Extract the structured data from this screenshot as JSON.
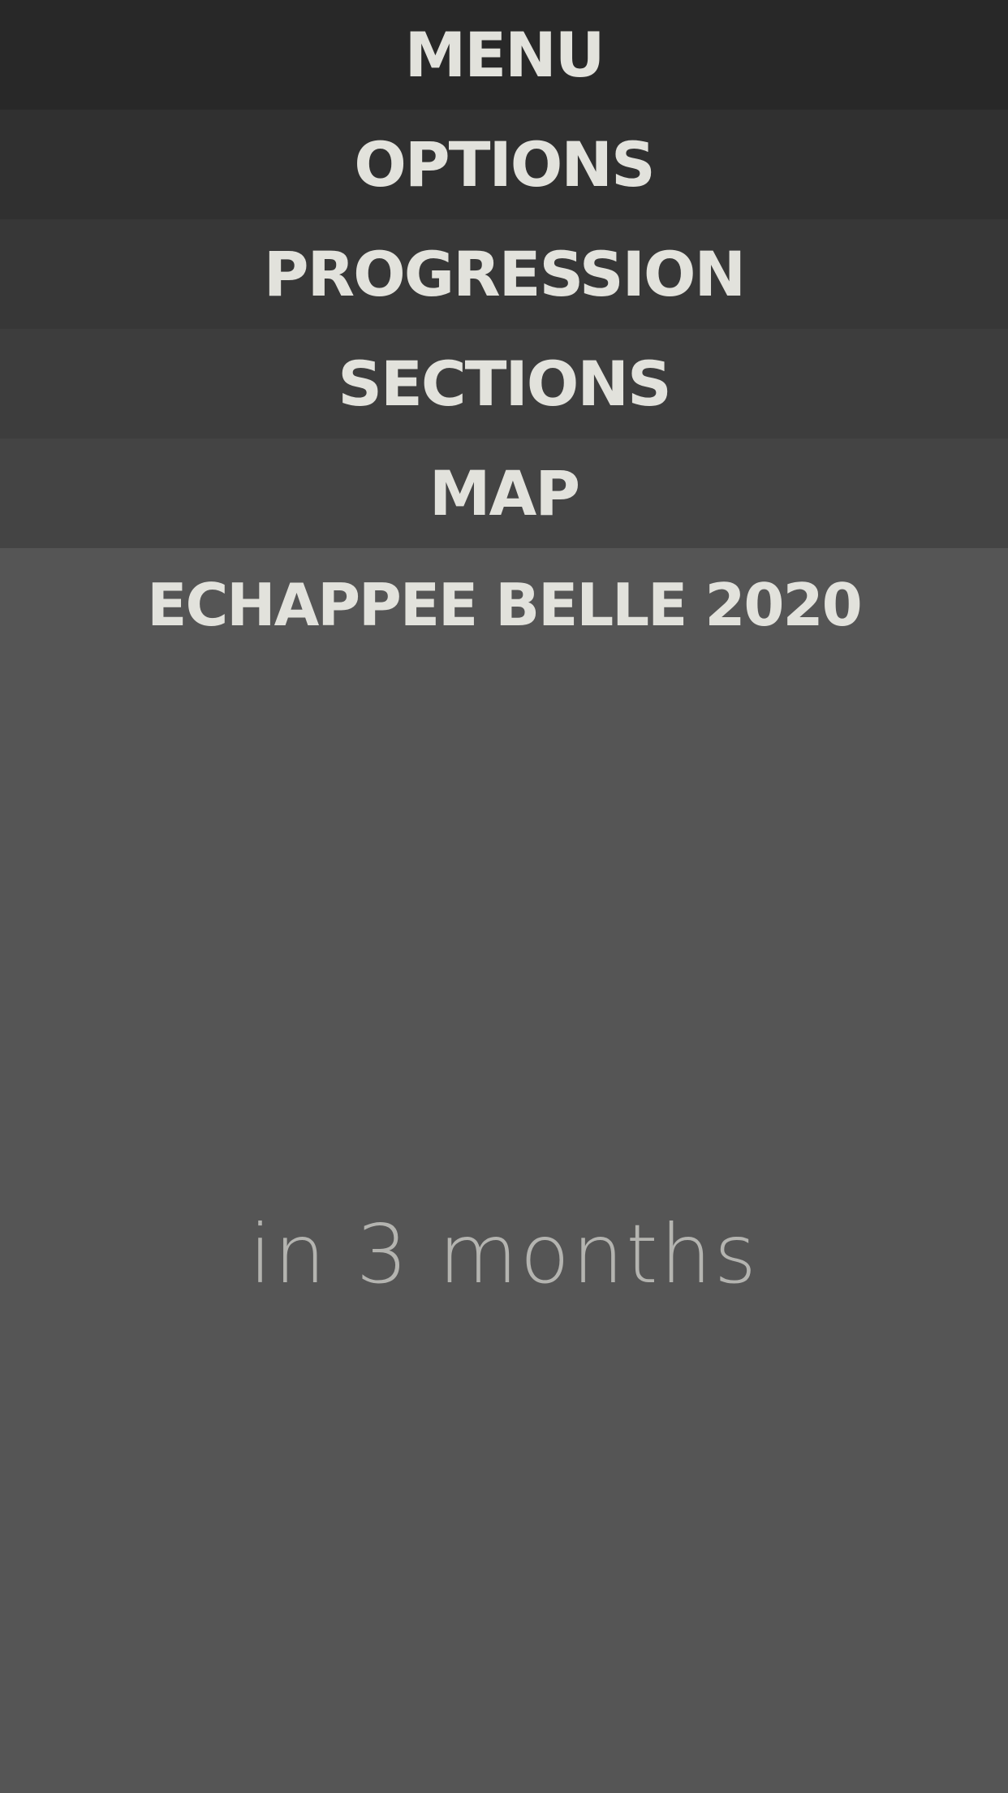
{
  "menu": {
    "items": [
      {
        "label": "MENU",
        "bg": "#282828"
      },
      {
        "label": "OPTIONS",
        "bg": "#303030"
      },
      {
        "label": "PROGRESSION",
        "bg": "#373737"
      },
      {
        "label": "SECTIONS",
        "bg": "#3d3d3d"
      },
      {
        "label": "MAP",
        "bg": "#444444"
      }
    ]
  },
  "event": {
    "title": "ECHAPPEE BELLE 2020",
    "countdown": "in 3 months"
  },
  "colors": {
    "background": "#555555",
    "text_primary": "#e2e2dc",
    "text_secondary": "#b4b4b0"
  }
}
